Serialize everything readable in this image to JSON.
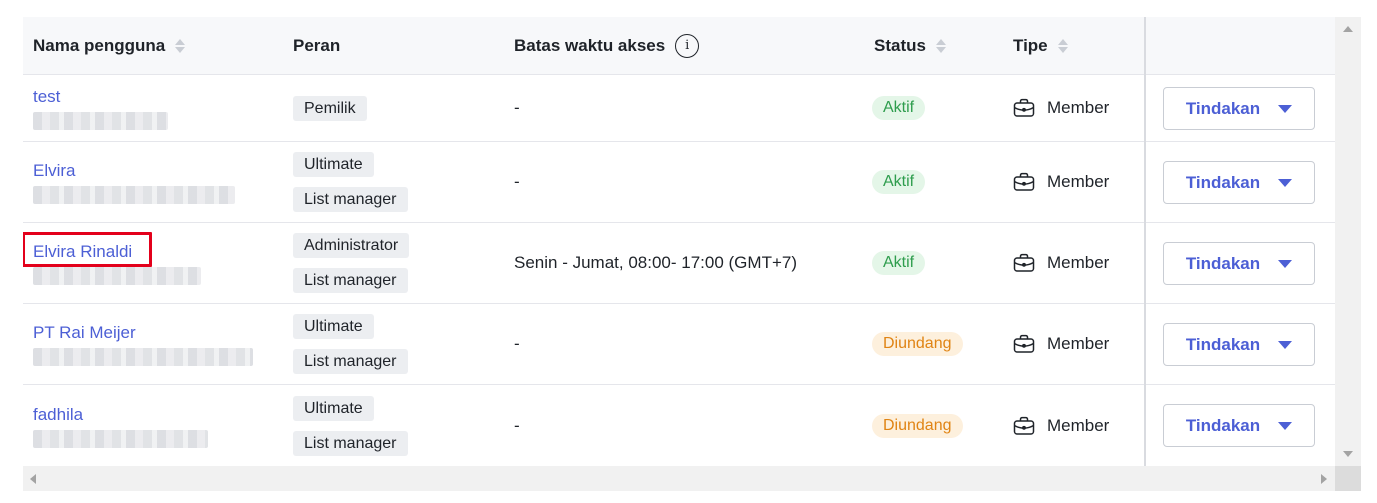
{
  "table": {
    "columns": {
      "username": "Nama pengguna",
      "role": "Peran",
      "access_limit": "Batas waktu akses",
      "status": "Status",
      "type": "Tipe"
    },
    "info_icon_glyph": "i",
    "rows": [
      {
        "username": "test",
        "roles": [
          "Pemilik"
        ],
        "access_limit": "-",
        "status": "Aktif",
        "status_kind": "active",
        "type": "Member",
        "action": "Tindakan"
      },
      {
        "username": "Elvira",
        "roles": [
          "Ultimate",
          "List manager"
        ],
        "access_limit": "-",
        "status": "Aktif",
        "status_kind": "active",
        "type": "Member",
        "action": "Tindakan"
      },
      {
        "username": "Elvira Rinaldi",
        "roles": [
          "Administrator",
          "List manager"
        ],
        "access_limit": "Senin - Jumat, 08:00- 17:00 (GMT+7)",
        "status": "Aktif",
        "status_kind": "active",
        "type": "Member",
        "action": "Tindakan",
        "highlighted": true
      },
      {
        "username": "PT Rai Meijer",
        "roles": [
          "Ultimate",
          "List manager"
        ],
        "access_limit": "-",
        "status": "Diundang",
        "status_kind": "invited",
        "type": "Member",
        "action": "Tindakan"
      },
      {
        "username": "fadhila",
        "roles": [
          "Ultimate",
          "List manager"
        ],
        "access_limit": "-",
        "status": "Diundang",
        "status_kind": "invited",
        "type": "Member",
        "action": "Tindakan"
      }
    ]
  },
  "colors": {
    "link": "#4c5fd5",
    "active_text": "#2e9d4d",
    "active_bg": "#e4f6e8",
    "invited_text": "#e08414",
    "invited_bg": "#fdf0dd",
    "highlight": "#e3001b",
    "header_bg": "#f7f8fa"
  },
  "icons": {
    "type_icon": "briefcase-icon",
    "action_icon": "caret-down-icon",
    "sort_icon": "sort-icon",
    "info_icon": "info-icon"
  }
}
